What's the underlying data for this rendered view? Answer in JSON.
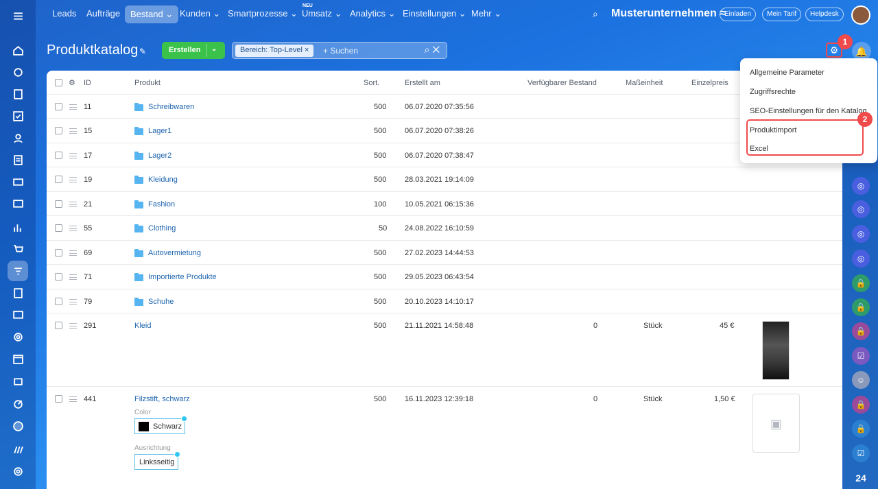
{
  "nav": {
    "items": [
      "Leads",
      "Aufträge",
      "Bestand ⌄",
      "Kunden ⌄",
      "Smartprozesse ⌄",
      "Umsatz ⌄",
      "Analytics ⌄",
      "Einstellungen ⌄",
      "Mehr ⌄"
    ],
    "new_badge": "NEU",
    "company": "Musterunternehmen ≈",
    "invite": "Einladen",
    "tariff": "Mein Tarif",
    "helpdesk": "Helpdesk"
  },
  "page": {
    "title": "Produktkatalog",
    "create_label": "Erstellen",
    "filter_chip": "Bereich: Top-Level ×",
    "search_placeholder": "+ Suchen",
    "markers": [
      "1",
      "2"
    ]
  },
  "table": {
    "headers": [
      "ID",
      "Produkt",
      "Sort.",
      "Erstellt am",
      "Verfügbarer Bestand",
      "Maßeinheit",
      "Einzelpreis"
    ],
    "rows": [
      {
        "id": "11",
        "name": "Schreibwaren",
        "sort": "500",
        "created": "06.07.2020 07:35:56"
      },
      {
        "id": "15",
        "name": "Lager1",
        "sort": "500",
        "created": "06.07.2020 07:38:26"
      },
      {
        "id": "17",
        "name": "Lager2",
        "sort": "500",
        "created": "06.07.2020 07:38:47"
      },
      {
        "id": "19",
        "name": "Kleidung",
        "sort": "500",
        "created": "28.03.2021 19:14:09"
      },
      {
        "id": "21",
        "name": "Fashion",
        "sort": "100",
        "created": "10.05.2021 06:15:36"
      },
      {
        "id": "55",
        "name": "Clothing",
        "sort": "50",
        "created": "24.08.2022 16:10:59"
      },
      {
        "id": "69",
        "name": "Autovermietung",
        "sort": "500",
        "created": "27.02.2023 14:44:53"
      },
      {
        "id": "71",
        "name": "Importierte Produkte",
        "sort": "500",
        "created": "29.05.2023 06:43:54"
      },
      {
        "id": "79",
        "name": "Schuhe",
        "sort": "500",
        "created": "20.10.2023 14:10:17"
      }
    ],
    "product1": {
      "id": "291",
      "name": "Kleid",
      "sort": "500",
      "created": "21.11.2021 14:58:48",
      "stock": "0",
      "unit": "Stück",
      "price": "45 €"
    },
    "product2": {
      "id": "441",
      "name": "Filzstift, schwarz",
      "sort": "500",
      "created": "16.11.2023 12:39:18",
      "stock": "0",
      "unit": "Stück",
      "price": "1,50 €",
      "color_label": "Color",
      "color_value": "Schwarz",
      "orient_label": "Ausrichtung",
      "orient_value": "Linksseitig"
    }
  },
  "menu": [
    "Allgemeine Parameter",
    "Zugriffsrechte",
    "SEO-Einstellungen für den Katalog",
    "Produktimport",
    "Excel"
  ],
  "rightbar": {
    "counter": "24"
  }
}
